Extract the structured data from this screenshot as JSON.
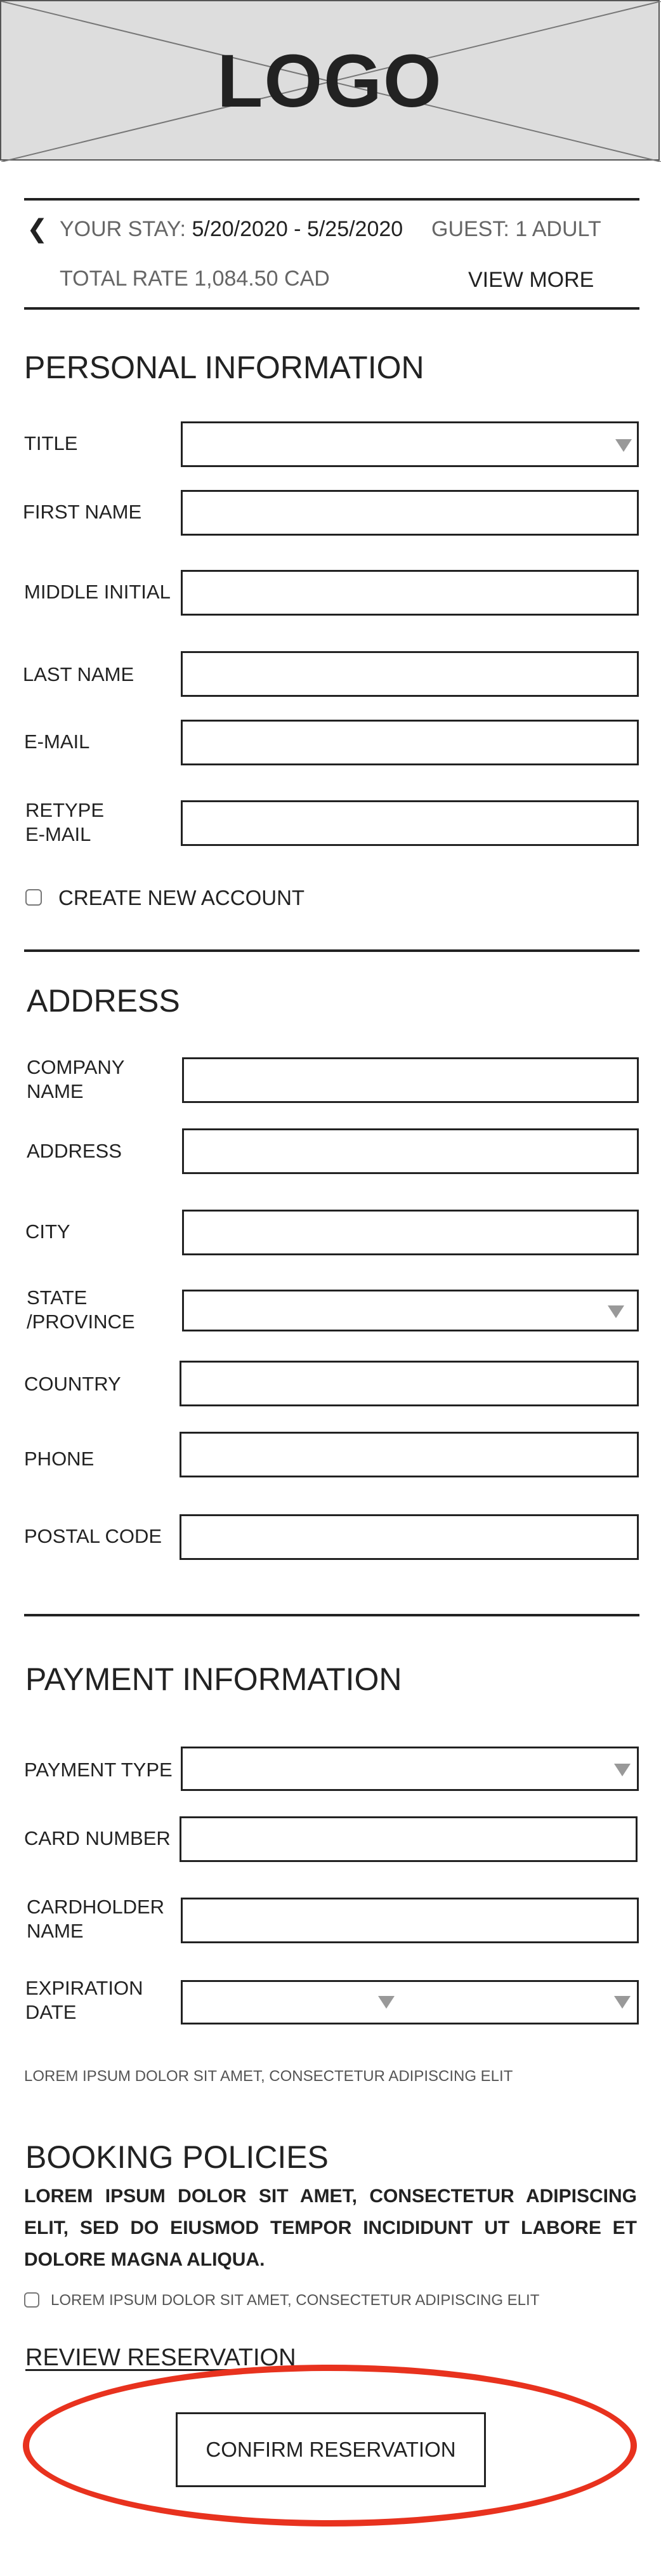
{
  "header": {
    "logo_text": "LOGO"
  },
  "summary": {
    "stay_label": "YOUR STAY:",
    "stay_dates": "5/20/2020 - 5/25/2020",
    "guest": "GUEST: 1 ADULT",
    "total_rate": "TOTAL RATE 1,084.50 CAD",
    "view_more": "VIEW MORE"
  },
  "personal": {
    "title": "PERSONAL INFORMATION",
    "labels": {
      "title": "TITLE",
      "first_name": "FIRST NAME",
      "middle_initial": "MIDDLE INITIAL",
      "last_name": "LAST NAME",
      "email": "E-MAIL",
      "retype_email_1": "RETYPE",
      "retype_email_2": "E-MAIL"
    },
    "create_account": "CREATE NEW ACCOUNT"
  },
  "address": {
    "title": "ADDRESS",
    "labels": {
      "company_1": "COMPANY",
      "company_2": "NAME",
      "address": "ADDRESS",
      "city": "CITY",
      "state_1": "STATE",
      "state_2": "/PROVINCE",
      "country": "COUNTRY",
      "phone": "PHONE",
      "postal_code": "POSTAL CODE"
    }
  },
  "payment": {
    "title": "PAYMENT INFORMATION",
    "labels": {
      "payment_type": "PAYMENT TYPE",
      "card_number": "CARD NUMBER",
      "cardholder_1": "CARDHOLDER",
      "cardholder_2": "NAME",
      "expiration_1": "EXPIRATION",
      "expiration_2": "DATE"
    },
    "note": "LOREM IPSUM DOLOR SIT AMET, CONSECTETUR ADIPISCING ELIT"
  },
  "policies": {
    "title": "BOOKING POLICIES",
    "text": "LOREM IPSUM DOLOR SIT AMET, CONSECTETUR ADIPISCING ELIT, SED DO EIUSMOD TEMPOR INCIDIDUNT UT LABORE ET DOLORE MAGNA ALIQUA.",
    "agree": "LOREM IPSUM DOLOR SIT AMET, CONSECTETUR ADIPISCING ELIT"
  },
  "review": {
    "label": "REVIEW RESERVATION"
  },
  "confirm": {
    "label": "CONFIRM RESERVATION"
  },
  "colors": {
    "highlight": "#e8321e",
    "placeholder_bg": "#dddddd"
  }
}
